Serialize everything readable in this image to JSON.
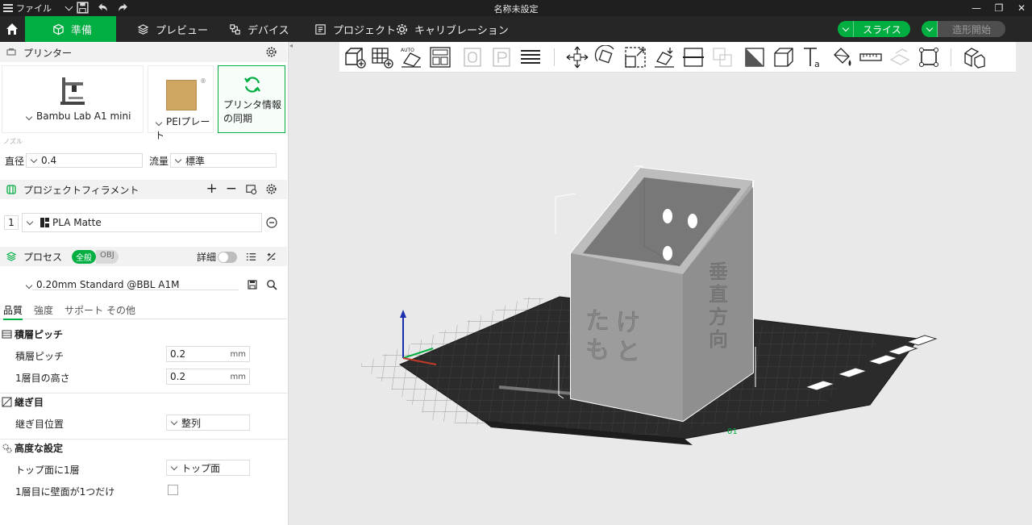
{
  "titlebar": {
    "menu_label": "ファイル",
    "title": "名称未設定",
    "minimize": "—",
    "restore": "❐",
    "close": "✕"
  },
  "tabs": [
    {
      "label": "準備",
      "icon": "cube-icon",
      "active": true
    },
    {
      "label": "プレビュー",
      "icon": "layers-icon"
    },
    {
      "label": "デバイス",
      "icon": "device-icon"
    },
    {
      "label": "プロジェクト",
      "icon": "project-icon"
    },
    {
      "label": "キャリブレーション",
      "icon": "calibration-icon"
    }
  ],
  "actions": {
    "slice": "スライス",
    "print": "造形開始"
  },
  "printer": {
    "section_title": "プリンター",
    "model": "Bambu Lab A1 mini",
    "plate": "PEIプレート",
    "sync_label": "プリンタ情報の同期",
    "nozzle_label": "ノズル",
    "diameter_label": "直径",
    "diameter_value": "0.4",
    "flow_label": "流量",
    "flow_value": "標準"
  },
  "filament": {
    "section_title": "プロジェクトフィラメント",
    "slot": "1",
    "name": "PLA Matte",
    "add": "+",
    "remove": "−"
  },
  "process": {
    "section_title": "プロセス",
    "global_tag": "全般",
    "obj_tag": "OBJ",
    "detail_label": "詳細",
    "profile": "0.20mm Standard @BBL A1M"
  },
  "subtabs": [
    "品質",
    "強度",
    "サポート",
    "その他"
  ],
  "groups": {
    "layer": {
      "title": "積層ピッチ",
      "rows": [
        {
          "label": "積層ピッチ",
          "value": "0.2",
          "unit": "mm"
        },
        {
          "label": "1層目の高さ",
          "value": "0.2",
          "unit": "mm"
        }
      ]
    },
    "seam": {
      "title": "継ぎ目",
      "rows": [
        {
          "label": "継ぎ目位置",
          "value": "整列"
        }
      ]
    },
    "advanced": {
      "title": "高度な設定",
      "rows": [
        {
          "label": "トップ面に1層",
          "value": "トップ面"
        },
        {
          "label": "1層目に壁面が1つだけ"
        }
      ]
    }
  },
  "model": {
    "front_text": [
      "け",
      "と",
      "た",
      "も"
    ],
    "side_text": [
      "垂",
      "直",
      "方",
      "向"
    ],
    "bed_label": "01",
    "body_color": "#a9a9a9",
    "bed_color": "#2b2b2b",
    "accent": "#00ae42"
  }
}
